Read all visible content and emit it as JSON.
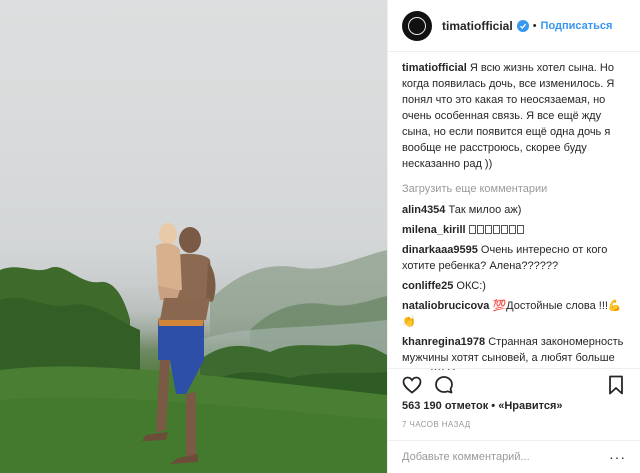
{
  "header": {
    "username": "timatiofficial",
    "separator": "•",
    "follow_label": "Подписаться"
  },
  "caption": {
    "username": "timatiofficial",
    "text": "Я всю жизнь хотел сына. Но когда появилась дочь, все изменилось. Я понял что это какая то неосязаемая, но очень особенная связь. Я все ещё жду сына, но если появится ещё одна дочь я вообще не расстроюсь, скорее буду несказанно рад ))"
  },
  "load_more_label": "Загрузить еще комментарии",
  "comments": [
    {
      "username": "alin4354",
      "text": "Так милоо аж)"
    },
    {
      "username": "milena_kirill",
      "text": ""
    },
    {
      "username": "dinarkaaa9595",
      "text": "Очень интересно от кого хотите ребенка? Алена??????"
    },
    {
      "username": "conliffe25",
      "text": "ОКС:)"
    },
    {
      "username": "nataliobrucicova",
      "text": "💯Достойные слова !!!💪👏"
    },
    {
      "username": "khanregina1978",
      "text": "Странная закономерность мужчины хотят сыновей, а любят больше дочек))))😏"
    }
  ],
  "likes": {
    "count_text": "563 190 отметок",
    "separator": "•",
    "like_label": "«Нравится»"
  },
  "timestamp": "7 ЧАСОВ НАЗАД",
  "add_comment": {
    "placeholder": "Добавьте комментарий...",
    "more_label": "···"
  },
  "icons": {
    "like": "heart-outline-icon",
    "comment": "comment-bubble-icon",
    "save": "bookmark-icon",
    "verified": "verified-badge-icon"
  },
  "colors": {
    "link_blue": "#3897f0",
    "text": "#262626",
    "muted": "#999999"
  }
}
